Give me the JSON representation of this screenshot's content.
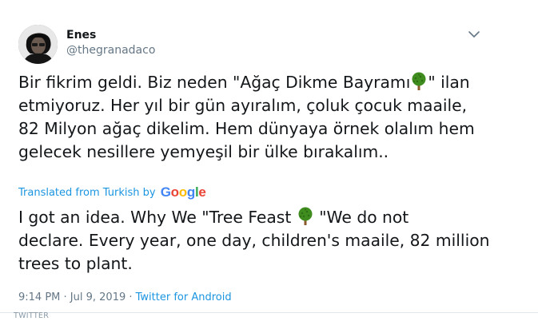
{
  "user": {
    "name": "Enes",
    "handle": "@thegranadaco"
  },
  "tweet": {
    "original_lines": [
      [
        "Bir fikrim geldi. Biz neden \"Ağaç Dikme Bayramı",
        "\" ilan"
      ],
      "etmiyoruz. Her yıl bir gün ayıralım, çoluk çocuk maaile,",
      "82 Milyon ağaç dikelim. Hem dünyaya örnek olalım hem",
      "gelecek nesillere yemyeşil bir ülke bırakalım.."
    ],
    "translation_label": "Translated from Turkish by",
    "translation_provider": "Google",
    "translated_lines": [
      [
        "I got an idea. Why We \"Tree Feast ",
        " \"We do not"
      ],
      "declare. Every year, one day, children's maaile, 82 million",
      "trees to plant."
    ],
    "time": "9:14 PM",
    "date": "Jul 9, 2019",
    "separator": " · ",
    "source": "Twitter for Android"
  },
  "icons": {
    "tree": "deciduous-tree-emoji",
    "caret": "chevron-down-icon"
  },
  "colors": {
    "link": "#1b95e0",
    "text": "#14171a",
    "muted": "#657786",
    "tree": "#3f8c1f",
    "trunk": "#8a5a2b",
    "google_blue": "#4285F4",
    "google_red": "#EA4335",
    "google_yellow": "#FBBC05",
    "google_green": "#34A853"
  },
  "footer": {
    "label": "TWITTER"
  }
}
